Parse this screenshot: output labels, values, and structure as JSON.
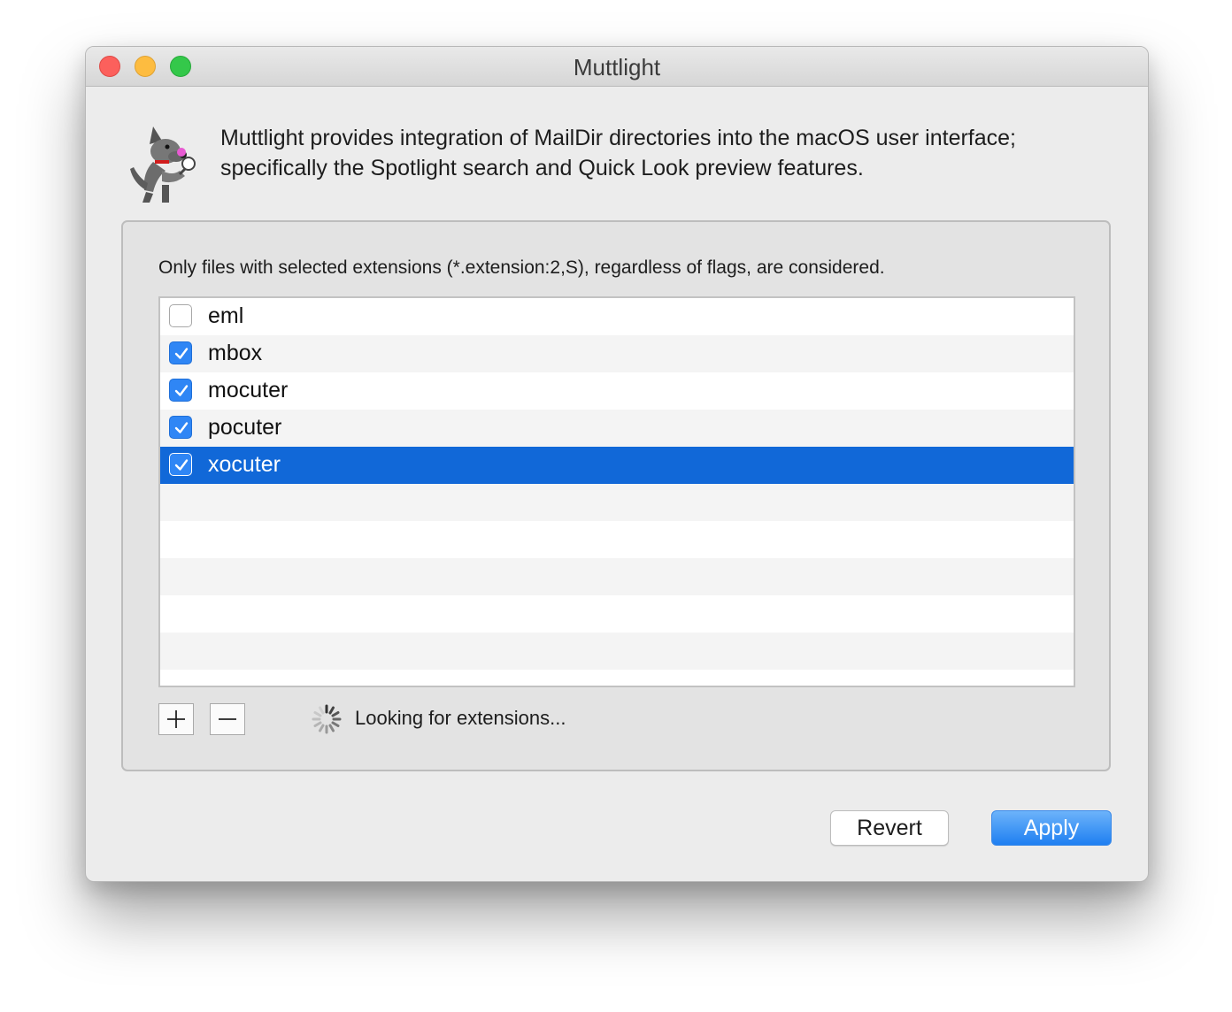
{
  "window": {
    "title": "Muttlight"
  },
  "intro": {
    "text": "Muttlight provides integration of MailDir directories into the macOS user interface; specifically the Spotlight search and Quick Look preview features."
  },
  "extensions": {
    "hint": "Only files with selected extensions (*.extension:2,S), regardless of flags, are considered.",
    "items": [
      {
        "label": "eml",
        "checked": false,
        "selected": false
      },
      {
        "label": "mbox",
        "checked": true,
        "selected": false
      },
      {
        "label": "mocuter",
        "checked": true,
        "selected": false
      },
      {
        "label": "pocuter",
        "checked": true,
        "selected": false
      },
      {
        "label": "xocuter",
        "checked": true,
        "selected": true
      }
    ],
    "status": "Looking for extensions..."
  },
  "buttons": {
    "revert": "Revert",
    "apply": "Apply"
  },
  "colors": {
    "selection": "#1168d8",
    "checkbox_checked": "#2f86f5",
    "apply_button": "#2f86f5"
  },
  "icons": {
    "app": "dog-magnifier-icon",
    "add": "plus-icon",
    "remove": "minus-icon",
    "progress": "spinner-icon"
  }
}
